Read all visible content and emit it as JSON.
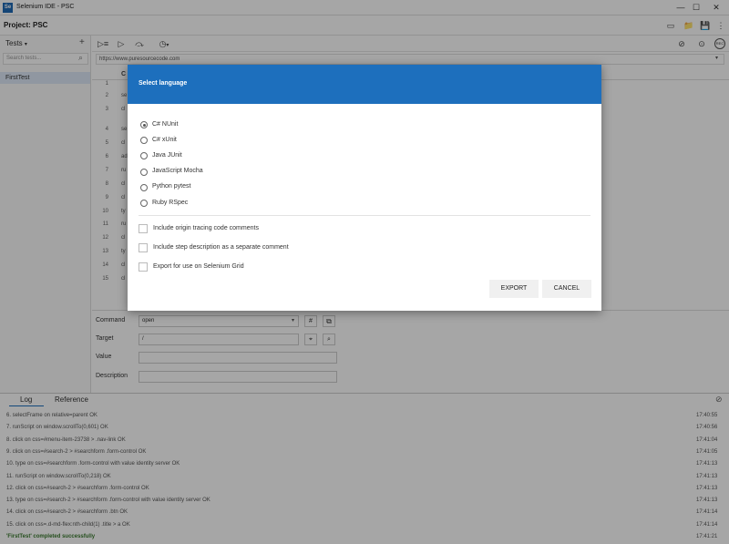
{
  "window": {
    "title": "Selenium IDE - PSC",
    "app_icon": "Se",
    "min": "—",
    "max": "☐",
    "close": "✕"
  },
  "project": {
    "label": "Project:  PSC"
  },
  "sidebar": {
    "tests_label": "Tests",
    "dropdown_caret": "▾",
    "add": "+",
    "search_placeholder": "Search tests...",
    "search_icon": "⌕",
    "items": [
      {
        "label": "FirstTest"
      }
    ]
  },
  "toolbar": {
    "url": "https://www.puresourcecode.com",
    "url_caret": "▾",
    "rec": "REC",
    "speed_caret": "▾"
  },
  "table": {
    "header_fragment": "C",
    "rows": [
      {
        "num": "1",
        "text": ""
      },
      {
        "num": "2",
        "text": "se"
      },
      {
        "num": "3",
        "text": "cl"
      },
      {
        "num": "4",
        "text": "se"
      },
      {
        "num": "5",
        "text": "cl"
      },
      {
        "num": "6",
        "text": "ad"
      },
      {
        "num": "7",
        "text": "ru"
      },
      {
        "num": "8",
        "text": "cl"
      },
      {
        "num": "9",
        "text": "cl"
      },
      {
        "num": "10",
        "text": "ty"
      },
      {
        "num": "11",
        "text": "ru"
      },
      {
        "num": "12",
        "text": "cl"
      },
      {
        "num": "13",
        "text": "ty"
      },
      {
        "num": "14",
        "text": "cl"
      },
      {
        "num": "15",
        "text": "cl"
      }
    ]
  },
  "details": {
    "command_label": "Command",
    "command_value": "open",
    "command_caret": "▾",
    "hash": "#",
    "target_label": "Target",
    "target_value": "/",
    "value_label": "Value",
    "value_value": "",
    "description_label": "Description",
    "description_value": ""
  },
  "log": {
    "tabs": [
      "Log",
      "Reference"
    ],
    "clear_icon": "⊘",
    "entries": [
      {
        "text": "6.  selectFrame on relative=parent OK",
        "time": "17:40:55"
      },
      {
        "text": "7.  runScript on window.scrollTo(0,601) OK",
        "time": "17:40:56"
      },
      {
        "text": "8.  click on css=#menu-item-23738 > .nav-link OK",
        "time": "17:41:04"
      },
      {
        "text": "9.  click on css=#search-2 > #searchform .form-control OK",
        "time": "17:41:05"
      },
      {
        "text": "10. type on css=#searchform .form-control with value identity server OK",
        "time": "17:41:13"
      },
      {
        "text": "11. runScript on window.scrollTo(0,218) OK",
        "time": "17:41:13"
      },
      {
        "text": "12. click on css=#search-2 > #searchform .form-control OK",
        "time": "17:41:13"
      },
      {
        "text": "13. type on css=#search-2 > #searchform .form-control with value identity server OK",
        "time": "17:41:13"
      },
      {
        "text": "14. click on css=#search-2 > #searchform .btn OK",
        "time": "17:41:14"
      },
      {
        "text": "15. click on css=.d-md-flex:nth-child(1) .title > a OK",
        "time": "17:41:14"
      }
    ],
    "final": {
      "text": "'FirstTest' completed successfully",
      "time": "17:41:21"
    }
  },
  "dialog": {
    "title": "Select language",
    "languages": [
      "C# NUnit",
      "C# xUnit",
      "Java JUnit",
      "JavaScript Mocha",
      "Python pytest",
      "Ruby RSpec"
    ],
    "selected_language": "C# NUnit",
    "options": [
      "Include origin tracing code comments",
      "Include step description as a separate comment",
      "Export for use on Selenium Grid"
    ],
    "export_label": "EXPORT",
    "cancel_label": "CANCEL"
  },
  "colors": {
    "dialog_header": "#1d6fbd",
    "selected_row": "#dde9f7"
  }
}
